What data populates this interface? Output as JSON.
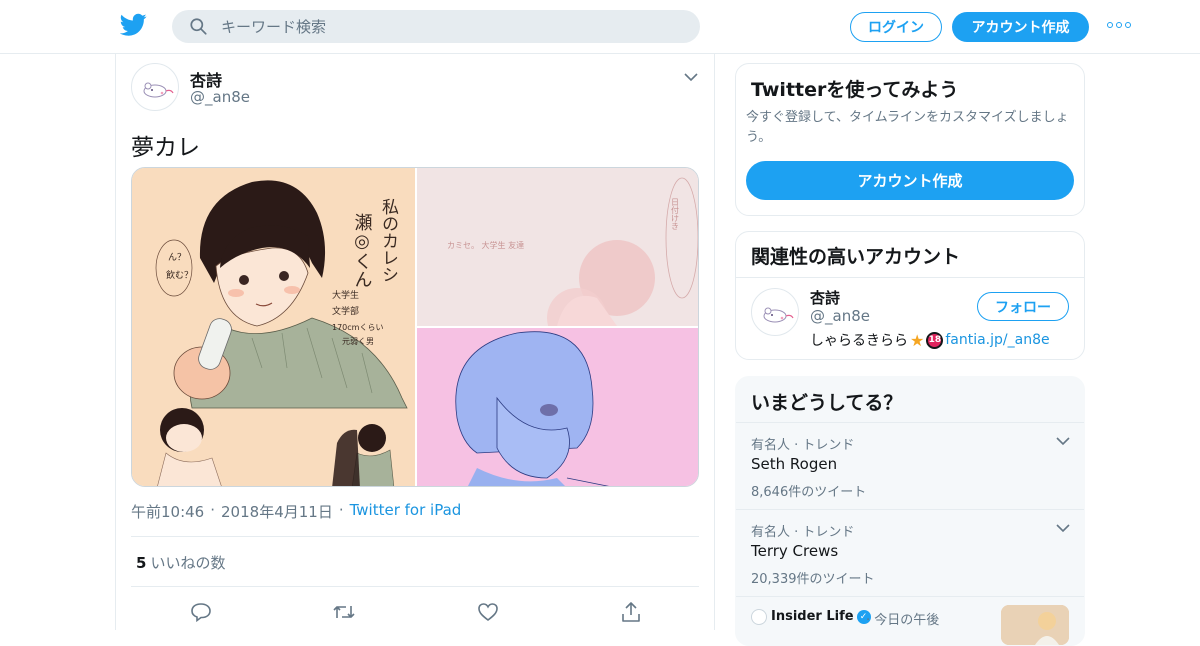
{
  "header": {
    "search_placeholder": "キーワード検索",
    "login_label": "ログイン",
    "signup_label": "アカウント作成",
    "accent": "#1da1f2"
  },
  "tweet": {
    "display_name": "杏詩",
    "handle": "@_an8e",
    "text": "夢カレ",
    "time": "午前10:46",
    "date": "2018年4月11日",
    "source": "Twitter for iPad",
    "likes_count": "5",
    "likes_label": "いいねの数",
    "media_text": {
      "a1": "私のカレシ",
      "a2": "瀬◎くん",
      "a3": "大学生",
      "a4": "文学部",
      "a5": "170cmくらい",
      "a6": "元弱く男",
      "a7": "ん？",
      "a8": "飲む？",
      "b1": "カミセ。 大学生 友達",
      "b2": "日付けき"
    }
  },
  "signup_card": {
    "title": "Twitterを使ってみよう",
    "desc": "今すぐ登録して、タイムラインをカスタマイズしましょう。",
    "button": "アカウント作成"
  },
  "related": {
    "title": "関連性の高いアカウント",
    "name": "杏詩",
    "handle": "@_an8e",
    "follow_label": "フォロー",
    "bio_text": "しゃらるきらら",
    "bio_badge": "18",
    "bio_link": "fantia.jp/_an8e"
  },
  "trends": {
    "title": "いまどうしてる？",
    "items": [
      {
        "context": "有名人 · トレンド",
        "name": "Seth Rogen",
        "count": "8,646件のツイート"
      },
      {
        "context": "有名人 · トレンド",
        "name": "Terry Crews",
        "count": "20,339件のツイート"
      }
    ],
    "story": {
      "source": "Insider Life",
      "when": "· 今日の午後"
    }
  }
}
